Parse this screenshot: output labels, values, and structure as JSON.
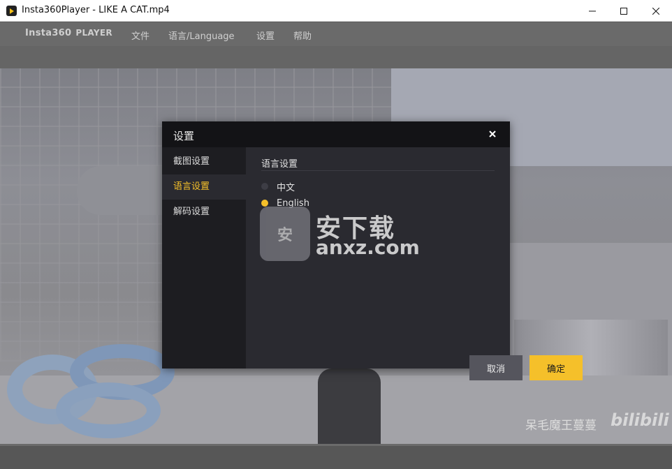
{
  "window": {
    "title": "Insta360Player - LIKE A CAT.mp4",
    "controls": {
      "minimize_icon": "minimize-icon",
      "maximize_icon": "maximize-icon",
      "close_icon": "close-icon"
    }
  },
  "menubar": {
    "brand_main": "Insta360",
    "brand_sub": "PLAYER",
    "items": [
      "文件",
      "语言/Language",
      "设置",
      "帮助"
    ]
  },
  "video": {
    "watermark": "呆毛魔王蔓蔓",
    "watermark_logo": "bilibili"
  },
  "dialog": {
    "title": "设置",
    "close_icon": "close-icon",
    "sidebar": [
      {
        "label": "截图设置",
        "active": false
      },
      {
        "label": "语言设置",
        "active": true
      },
      {
        "label": "解码设置",
        "active": false
      }
    ],
    "section_title": "语言设置",
    "options": [
      {
        "label": "中文",
        "checked": false
      },
      {
        "label": "English",
        "checked": true
      }
    ],
    "cancel_label": "取消",
    "ok_label": "确定"
  },
  "site_watermark": {
    "shield_char": "安",
    "cn": "安下载",
    "en": "anxz.com"
  },
  "colors": {
    "accent": "#f5c02a",
    "dialog_bg": "#2a2a30",
    "dialog_header": "#131316",
    "sidebar_bg": "#1d1d21"
  }
}
